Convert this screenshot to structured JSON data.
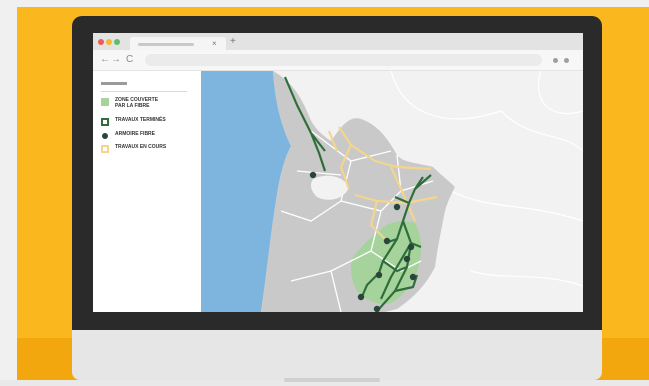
{
  "colors": {
    "backdrop": "#fbb81e",
    "zone_couverte": "#a6d39b",
    "travaux_termines": "#2f6e3a",
    "armoire_fibre": "#28463a",
    "travaux_en_cours": "#f3d58e",
    "departement": "#c9c9c9",
    "ocean": "#7db5de"
  },
  "browser": {
    "tab_close_icon": "close-icon",
    "tab_close_glyph": "×",
    "new_tab_glyph": "+",
    "back_glyph": "←",
    "forward_glyph": "→",
    "reload_glyph": "C"
  },
  "legend": {
    "items": [
      {
        "icon": "green-square",
        "label": "ZONE COUVERTE\nPAR LA FIBRE"
      },
      {
        "icon": "green-outline-square",
        "label": "TRAVAUX TERMINÉS"
      },
      {
        "icon": "dark-dot",
        "label": "ARMOIRE FIBRE"
      },
      {
        "icon": "yellow-outline-square",
        "label": "TRAVAUX EN COURS"
      }
    ]
  }
}
